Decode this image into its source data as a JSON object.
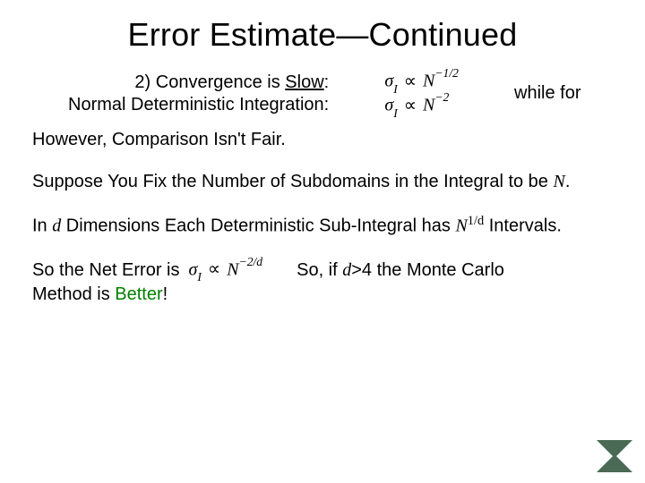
{
  "title": "Error Estimate—Continued",
  "row1": {
    "left_line1_prefix": "2) Convergence is ",
    "left_line1_slow": "Slow",
    "left_line1_colon": ":",
    "left_line2": "Normal Deterministic Integration:",
    "right": "while for"
  },
  "math": {
    "sigma": "σ",
    "sub_I": "I",
    "propto": "∝",
    "N": "N",
    "exp_minus_half": "−1/2",
    "exp_minus_two": "−2",
    "exp_minus_2_over_d": "−2/d"
  },
  "para2": "However, Comparison Isn't Fair.",
  "para3": {
    "a": "Suppose You Fix the Number of Subdomains in the Integral to be ",
    "N": "N",
    "dot": "."
  },
  "para4": {
    "a": "In ",
    "d": "d",
    "b": " Dimensions Each Deterministic Sub-Integral has ",
    "N": "N",
    "exp": "1/d",
    "c": " Intervals."
  },
  "para5": {
    "a": "So the Net Error is",
    "b": "So, if ",
    "d": "d",
    "c": ">4 the Monte Carlo",
    "line2a": "Method is ",
    "better": "Better",
    "line2b": "!"
  },
  "logo_name": "hourglass-logo"
}
